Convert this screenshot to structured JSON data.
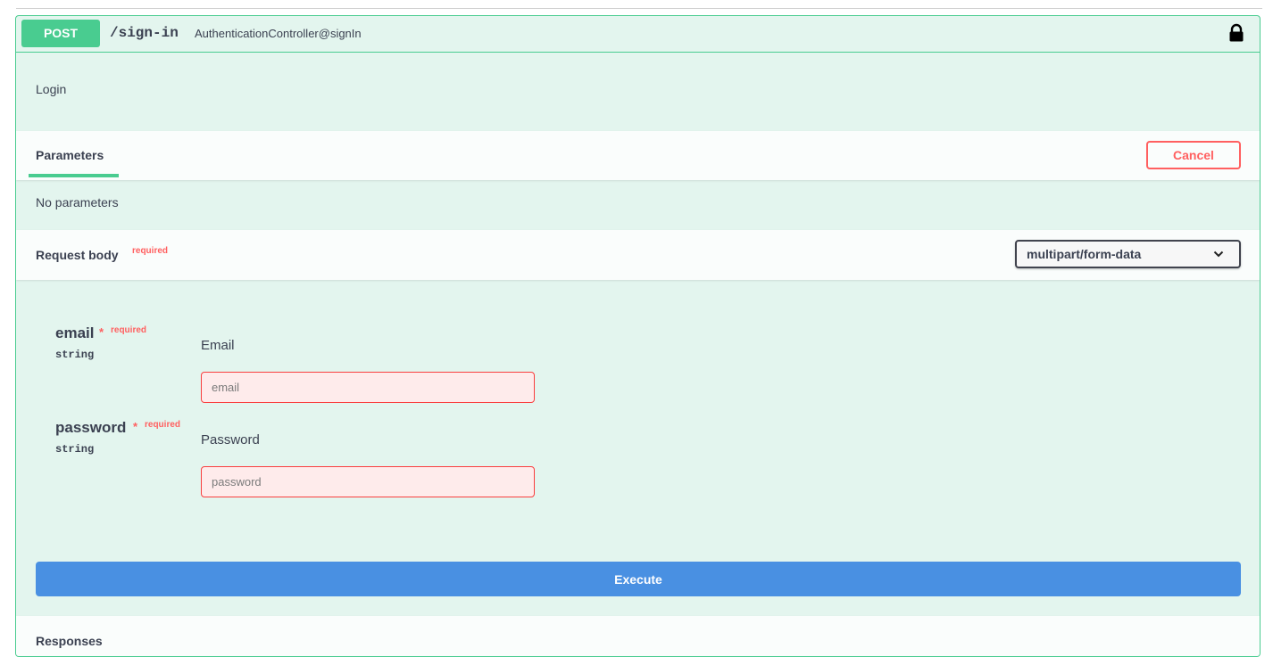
{
  "operation": {
    "method": "POST",
    "path": "/sign-in",
    "controller": "AuthenticationController@signIn",
    "description": "Login",
    "method_color": "#49cc90"
  },
  "parameters": {
    "tab_label": "Parameters",
    "cancel_label": "Cancel",
    "empty_text": "No parameters"
  },
  "request_body": {
    "label": "Request body",
    "required_label": "required",
    "content_type": "multipart/form-data",
    "fields": [
      {
        "name": "email",
        "star": "*",
        "required_label": "required",
        "type": "string",
        "description": "Email",
        "placeholder": "email"
      },
      {
        "name": "password",
        "star": "*",
        "required_label": "required",
        "type": "string",
        "description": "Password",
        "placeholder": "password"
      }
    ]
  },
  "execute_label": "Execute",
  "responses_label": "Responses",
  "colors": {
    "success_green": "#49cc90",
    "danger_red": "#ff6060",
    "execute_blue": "#4990e2",
    "panel_bg": "#e3f5ee"
  },
  "icons": {
    "lock": "lock-icon",
    "chevron": "chevron-down-icon"
  }
}
